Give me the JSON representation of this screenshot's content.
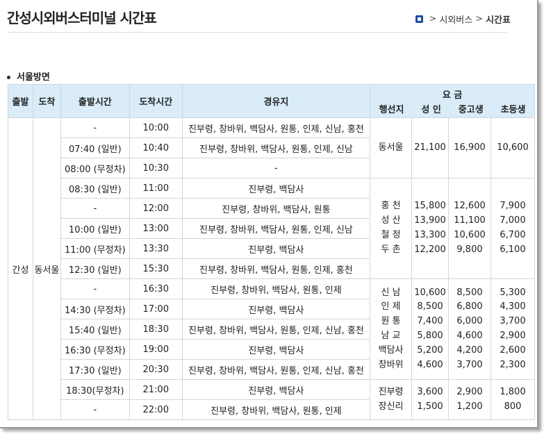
{
  "page": {
    "title": "간성시외버스터미널 시간표",
    "breadcrumb": [
      "시외버스",
      "시간표"
    ]
  },
  "section": {
    "title": "서울방면"
  },
  "table": {
    "headers": {
      "depart": "출발",
      "arrive": "도착",
      "depart_time": "출발시간",
      "arrive_time": "도착시간",
      "via": "경유지",
      "fare": "요 금",
      "destination": "행선지",
      "adult": "성 인",
      "teen": "중고생",
      "child": "초등생"
    },
    "depart_place": "간성",
    "arrive_place": "동서울",
    "rows": [
      {
        "depart_time": "-",
        "arrive_time": "10:00",
        "via": "진부령, 창바위, 백담사, 원통, 인제, 신남, 홍천"
      },
      {
        "depart_time": "07:40 (일반)",
        "arrive_time": "10:40",
        "via": "진부령, 창바위, 백담사, 원통, 인제, 신남"
      },
      {
        "depart_time": "08:00 (무정차)",
        "arrive_time": "10:30",
        "via": "-"
      },
      {
        "depart_time": "08:30 (일반)",
        "arrive_time": "11:00",
        "via": "진부령, 백담사"
      },
      {
        "depart_time": "-",
        "arrive_time": "12:00",
        "via": "진부령, 창바위, 백담사, 원통"
      },
      {
        "depart_time": "10:00 (일반)",
        "arrive_time": "13:00",
        "via": "진부령, 창바위, 백담사, 원통, 인제, 신남"
      },
      {
        "depart_time": "11:00 (무정차)",
        "arrive_time": "13:30",
        "via": "진부령, 백담사"
      },
      {
        "depart_time": "12:30 (일반)",
        "arrive_time": "15:30",
        "via": "진부령, 창바위, 백담사, 원통, 인제, 홍천"
      },
      {
        "depart_time": "-",
        "arrive_time": "16:30",
        "via": "진부령, 창바위, 백담사, 원통, 인제"
      },
      {
        "depart_time": "14:30 (무정차)",
        "arrive_time": "17:00",
        "via": "진부령, 백담사"
      },
      {
        "depart_time": "15:40 (일반)",
        "arrive_time": "18:30",
        "via": "진부령, 창바위, 백담사, 원통, 인제, 신남, 홍천"
      },
      {
        "depart_time": "16:30 (무정차)",
        "arrive_time": "19:00",
        "via": "진부령, 백담사"
      },
      {
        "depart_time": "17:30 (일반)",
        "arrive_time": "20:30",
        "via": "진부령, 창바위, 백담사, 원통, 인제, 신남, 홍천"
      },
      {
        "depart_time": "18:30(무정차)",
        "arrive_time": "21:00",
        "via": "진부령, 백담사"
      },
      {
        "depart_time": "-",
        "arrive_time": "22:00",
        "via": "진부령, 창바위, 백담사, 원통, 인제"
      }
    ],
    "fare_groups": [
      [
        {
          "dest": "동서울",
          "adult": "21,100",
          "teen": "16,900",
          "child": "10,600"
        }
      ],
      [
        {
          "dest": "홍 천",
          "adult": "15,800",
          "teen": "12,600",
          "child": "7,900"
        },
        {
          "dest": "성 산",
          "adult": "13,900",
          "teen": "11,100",
          "child": "7,000"
        },
        {
          "dest": "철 정",
          "adult": "13,300",
          "teen": "10,600",
          "child": "6,700"
        },
        {
          "dest": "두 촌",
          "adult": "12,200",
          "teen": "9,800",
          "child": "6,100"
        }
      ],
      [
        {
          "dest": "신 남",
          "adult": "10,600",
          "teen": "8,500",
          "child": "5,300"
        },
        {
          "dest": "인 제",
          "adult": "8,500",
          "teen": "6,800",
          "child": "4,300"
        },
        {
          "dest": "원 통",
          "adult": "7,400",
          "teen": "6,000",
          "child": "3,700"
        },
        {
          "dest": "남 교",
          "adult": "5,800",
          "teen": "4,600",
          "child": "2,900"
        },
        {
          "dest": "백담사",
          "adult": "5,200",
          "teen": "4,200",
          "child": "2,600"
        },
        {
          "dest": "창바위",
          "adult": "4,600",
          "teen": "3,700",
          "child": "2,300"
        }
      ],
      [
        {
          "dest": "진부령",
          "adult": "3,600",
          "teen": "2,900",
          "child": "1,800"
        },
        {
          "dest": "장신리",
          "adult": "1,500",
          "teen": "1,200",
          "child": "800"
        }
      ]
    ]
  },
  "colors": {
    "header_bg": "#d9ecf8",
    "border": "#cfd7df",
    "breadcrumb_icon": "#1f4f9e"
  }
}
